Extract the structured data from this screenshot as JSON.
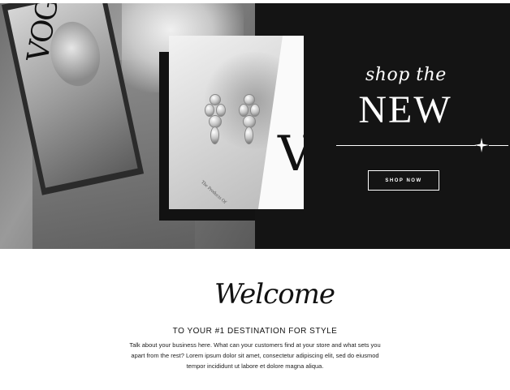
{
  "hero": {
    "script_title": "shop the",
    "big_title": "NEW",
    "cta_label": "SHOP NOW",
    "magazine_title": "VOGUE",
    "photo_card_letter": "V",
    "photo_card_caption": "The Products Of"
  },
  "welcome": {
    "script_title": "Welcome",
    "subheading": "TO YOUR #1 DESTINATION FOR STYLE",
    "body": "Talk about your business here. What can your customers find at your store and what sets you apart from the rest? Lorem ipsum dolor sit amet, consectetur adipiscing elit, sed do eiusmod tempor incididunt ut labore et dolore magna aliqua."
  },
  "colors": {
    "dark_panel": "#141414",
    "text": "#111111",
    "background": "#ffffff"
  },
  "icons": {
    "divider_ornament": "sparkle-icon"
  }
}
